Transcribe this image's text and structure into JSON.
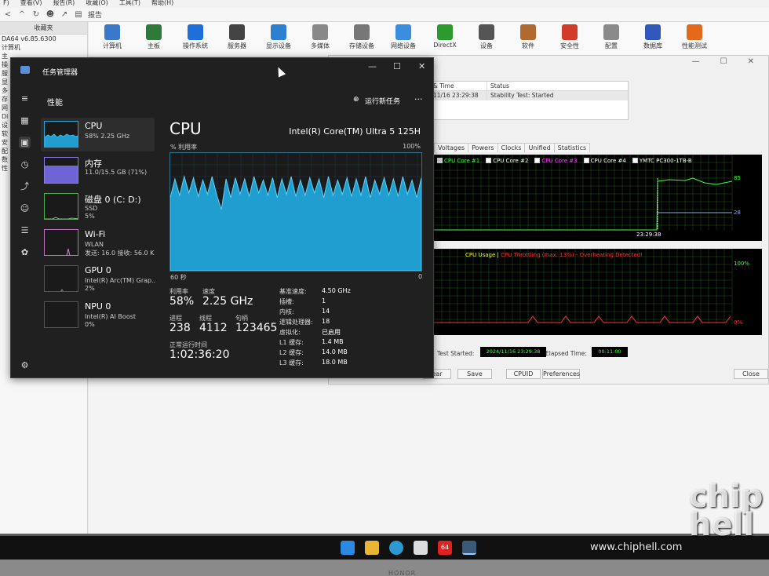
{
  "aida_menu": [
    "F)",
    "查看(V)",
    "报告(R)",
    "收藏(O)",
    "工具(T)",
    "帮助(H)"
  ],
  "aida_report": "报告",
  "left_pane": {
    "favorites": "收藏夹",
    "version": "DA64 v6.85.6300",
    "root": "计算机",
    "items": [
      "主",
      "操",
      "服",
      "显",
      "多",
      "存",
      "网",
      "Di",
      "设",
      "软",
      "安",
      "配",
      "数",
      "性"
    ]
  },
  "toolbar": [
    {
      "label": "计算机",
      "color": "#3a78c8"
    },
    {
      "label": "主板",
      "color": "#2f7a3a"
    },
    {
      "label": "操作系统",
      "color": "#1e6fd9"
    },
    {
      "label": "服务器",
      "color": "#444444"
    },
    {
      "label": "显示设备",
      "color": "#2d7fd0"
    },
    {
      "label": "多媒体",
      "color": "#888888"
    },
    {
      "label": "存储设备",
      "color": "#777777"
    },
    {
      "label": "网络设备",
      "color": "#3b8de0"
    },
    {
      "label": "DirectX",
      "color": "#2c9a2c"
    },
    {
      "label": "设备",
      "color": "#555555"
    },
    {
      "label": "软件",
      "color": "#b06a30"
    },
    {
      "label": "安全性",
      "color": "#d23b2b"
    },
    {
      "label": "配置",
      "color": "#8a8a8a"
    },
    {
      "label": "数据库",
      "color": "#2f58b8"
    },
    {
      "label": "性能测试",
      "color": "#e36a1a"
    }
  ],
  "stability": {
    "table_hdr1": "& Time",
    "table_hdr2": "Status",
    "row_time": "11/16 23:29:38",
    "row_status": "Stability Test: Started",
    "tabs": [
      "Voltages",
      "Powers",
      "Clocks",
      "Unified",
      "Statistics"
    ],
    "legend1": [
      "CPU Core #1",
      "CPU Core #2",
      "CPU Core #3",
      "CPU Core #4",
      "YMTC PC300-1TB-B"
    ],
    "legend1_colors": [
      "#44ff44",
      "#ffffff",
      "#ff44ff",
      "#ffffff",
      "#ffffff"
    ],
    "g1_val1": "85",
    "g1_val2": "28",
    "g1_time": "23:29:38",
    "legend2_a": "CPU Usage",
    "legend2_sep": "|",
    "legend2_b": "CPU Throttling (max: 13%) - Overheating Detected!",
    "g2_top": "100%",
    "g2_bot": "0%",
    "test_started_label": "Test Started:",
    "test_started_val": "2024/11/16 23:29:38",
    "elapsed_label": "Elapsed Time:",
    "elapsed_val": "00:11:00",
    "buttons": [
      "ear",
      "Save",
      "CPUID",
      "Preferences",
      "Close"
    ]
  },
  "tm": {
    "title": "任务管理器",
    "section": "性能",
    "run_task": "运行新任务",
    "more": "···",
    "items": [
      {
        "name": "CPU",
        "s1": "58% 2.25 GHz",
        "s2": ""
      },
      {
        "name": "内存",
        "s1": "11.0/15.5 GB (71%)",
        "s2": ""
      },
      {
        "name": "磁盘 0 (C: D:)",
        "s1": "SSD",
        "s2": "5%"
      },
      {
        "name": "Wi-Fi",
        "s1": "WLAN",
        "s2": "发送: 16.0 接收: 56.0 K"
      },
      {
        "name": "GPU 0",
        "s1": "Intel(R) Arc(TM) Grap..",
        "s2": "2%"
      },
      {
        "name": "NPU 0",
        "s1": "Intel(R) AI Boost",
        "s2": "0%"
      }
    ],
    "cpu_title": "CPU",
    "cpu_model": "Intel(R) Core(TM) Ultra 5 125H",
    "util_axis": "% 利用率",
    "axis_max": "100%",
    "axis_time": "60 秒",
    "axis_zero": "0",
    "utilization_label": "利用率",
    "utilization": "58%",
    "speed_label": "速度",
    "speed": "2.25 GHz",
    "proc_label": "进程",
    "proc": "238",
    "threads_label": "线程",
    "threads": "4112",
    "handles_label": "句柄",
    "handles": "123465",
    "uptime_label": "正常运行时间",
    "uptime": "1:02:36:20",
    "specs": [
      {
        "k": "基准速度:",
        "v": "4.50 GHz"
      },
      {
        "k": "插槽:",
        "v": "1"
      },
      {
        "k": "内核:",
        "v": "14"
      },
      {
        "k": "逻辑处理器:",
        "v": "18"
      },
      {
        "k": "虚拟化:",
        "v": "已启用"
      },
      {
        "k": "L1 缓存:",
        "v": "1.4 MB"
      },
      {
        "k": "L2 缓存:",
        "v": "14.0 MB"
      },
      {
        "k": "L3 缓存:",
        "v": "18.0 MB"
      }
    ],
    "cpu_history": [
      62,
      78,
      64,
      80,
      66,
      79,
      63,
      77,
      65,
      80,
      64,
      52,
      78,
      62,
      79,
      65,
      78,
      63,
      80,
      66,
      77,
      64,
      79,
      62,
      78,
      65,
      80,
      63,
      77,
      64,
      79,
      66,
      78,
      62,
      80,
      64,
      77,
      65,
      79,
      63,
      78,
      64,
      80,
      62,
      77,
      65,
      79,
      64,
      78,
      63,
      80,
      65,
      77,
      62,
      79
    ]
  },
  "taskbar_badge": "64",
  "watermark": "www.chiphell.com",
  "watermark_logo": "chip hell",
  "brand": "HONOR"
}
